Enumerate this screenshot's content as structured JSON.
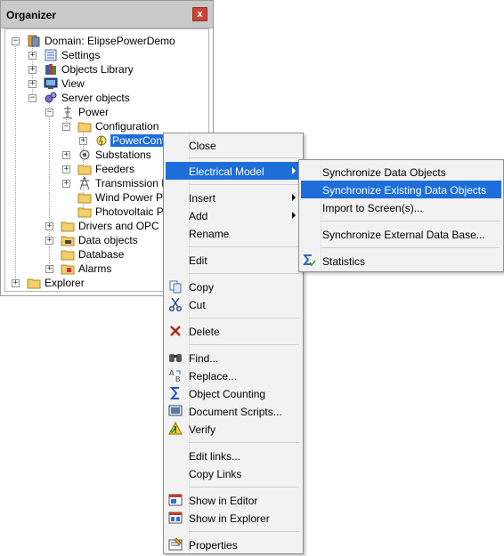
{
  "organizer": {
    "title": "Organizer",
    "close_glyph": "x",
    "tree": [
      {
        "label": "Domain: ElipsePowerDemo",
        "icon": "domain-icon",
        "expander": "−"
      },
      {
        "label": "Settings",
        "icon": "settings-icon",
        "expander": "+"
      },
      {
        "label": "Objects Library",
        "icon": "library-icon",
        "expander": "+"
      },
      {
        "label": "View",
        "icon": "view-icon",
        "expander": "+"
      },
      {
        "label": "Server objects",
        "icon": "server-objects-icon",
        "expander": "−"
      },
      {
        "label": "Power",
        "icon": "power-icon",
        "expander": "−"
      },
      {
        "label": "Configuration",
        "icon": "folder-icon",
        "expander": "−"
      },
      {
        "label": "PowerConfig",
        "icon": "power-config-icon",
        "expander": "+"
      },
      {
        "label": "Substations",
        "icon": "substations-icon",
        "expander": "+"
      },
      {
        "label": "Feeders",
        "icon": "folder-icon",
        "expander": "+"
      },
      {
        "label": "Transmission Line",
        "icon": "transmission-icon",
        "expander": "+"
      },
      {
        "label": "Wind Power Plan",
        "icon": "folder-icon",
        "expander": ""
      },
      {
        "label": "Photovoltaic Pow",
        "icon": "folder-icon",
        "expander": ""
      },
      {
        "label": "Drivers and OPC",
        "icon": "folder-icon",
        "expander": "+"
      },
      {
        "label": "Data objects",
        "icon": "data-objects-icon",
        "expander": "+"
      },
      {
        "label": "Database",
        "icon": "database-icon",
        "expander": ""
      },
      {
        "label": "Alarms",
        "icon": "alarms-icon",
        "expander": "+"
      },
      {
        "label": "Explorer",
        "icon": "explorer-folder-icon",
        "expander": "+"
      }
    ]
  },
  "context_menu": {
    "items": [
      {
        "label": "Close"
      },
      {
        "label": "Electrical Model"
      },
      {
        "label": "Insert"
      },
      {
        "label": "Add"
      },
      {
        "label": "Rename"
      },
      {
        "label": "Edit"
      },
      {
        "label": "Copy",
        "icon": "copy-icon"
      },
      {
        "label": "Cut",
        "icon": "cut-icon"
      },
      {
        "label": "Delete",
        "icon": "delete-icon"
      },
      {
        "label": "Find...",
        "icon": "binoculars-icon"
      },
      {
        "label": "Replace...",
        "icon": "replace-icon"
      },
      {
        "label": "Object Counting",
        "icon": "sigma-icon"
      },
      {
        "label": "Document Scripts...",
        "icon": "scripts-icon"
      },
      {
        "label": "Verify",
        "icon": "warning-icon"
      },
      {
        "label": "Edit links..."
      },
      {
        "label": "Copy Links"
      },
      {
        "label": "Show in Editor",
        "icon": "show-editor-icon"
      },
      {
        "label": "Show in Explorer",
        "icon": "show-explorer-icon"
      },
      {
        "label": "Properties",
        "icon": "properties-icon"
      }
    ]
  },
  "submenu": {
    "items": [
      {
        "label": "Synchronize Data Objects"
      },
      {
        "label": "Synchronize Existing Data Objects"
      },
      {
        "label": "Import to Screen(s)..."
      },
      {
        "label": "Synchronize External Data Base..."
      },
      {
        "label": "Statistics",
        "icon": "statistics-icon"
      }
    ]
  },
  "colors": {
    "selection": "#1e6ed9",
    "close_button": "#c4463a",
    "header": "#c9c9c9"
  }
}
